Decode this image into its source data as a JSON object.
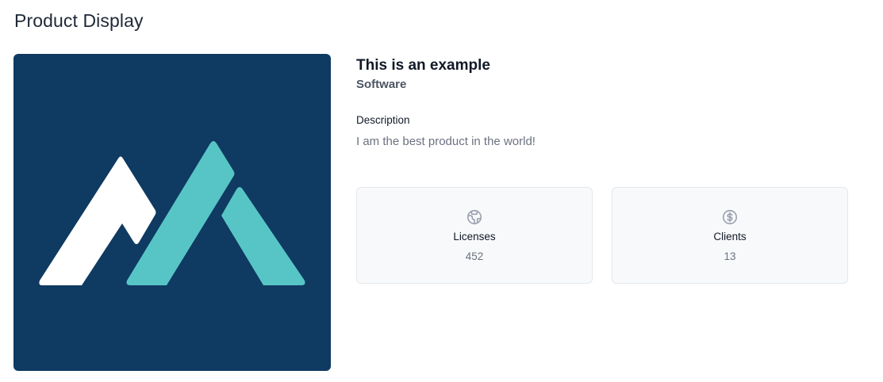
{
  "page": {
    "title": "Product Display"
  },
  "product": {
    "name": "This is an example",
    "category": "Software",
    "description_label": "Description",
    "description": "I am the best product in the world!",
    "image": {
      "icon": "mountain-logo",
      "background_color": "#0f3a61",
      "colors": [
        "#ffffff",
        "#57c5c6"
      ]
    }
  },
  "stats": [
    {
      "label": "Licenses",
      "value": "452",
      "icon": "globe-icon"
    },
    {
      "label": "Clients",
      "value": "13",
      "icon": "dollar-icon"
    }
  ],
  "colors": {
    "icon": "#9ca3af",
    "card_bg": "#f8f9fb",
    "card_border": "#e5e7eb"
  }
}
